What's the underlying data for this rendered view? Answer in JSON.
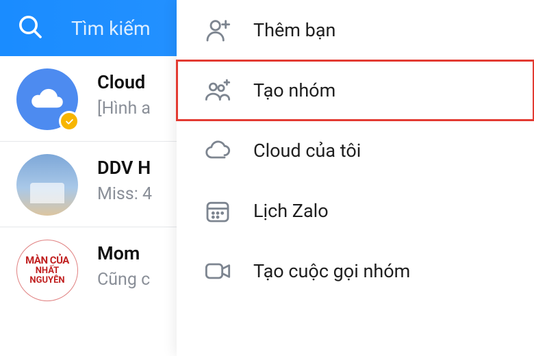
{
  "header": {
    "search_placeholder": "Tìm kiếm"
  },
  "chats": [
    {
      "title": "Cloud",
      "subtitle": "[Hình a"
    },
    {
      "title": "DDV H",
      "subtitle": "Miss: 4"
    },
    {
      "title": "Mom",
      "subtitle": "Cũng c"
    }
  ],
  "menu": {
    "items": [
      {
        "label": "Thêm bạn",
        "icon": "add-friend-icon",
        "highlighted": false
      },
      {
        "label": "Tạo nhóm",
        "icon": "create-group-icon",
        "highlighted": true
      },
      {
        "label": "Cloud của tôi",
        "icon": "cloud-icon",
        "highlighted": false
      },
      {
        "label": "Lịch Zalo",
        "icon": "calendar-icon",
        "highlighted": false
      },
      {
        "label": "Tạo cuộc gọi nhóm",
        "icon": "video-call-icon",
        "highlighted": false
      }
    ]
  },
  "avatar_sign": {
    "line1": "MÀN CỦA",
    "line2": "NHẤT NGUYÊN"
  },
  "colors": {
    "header_gradient_start": "#1a8cff",
    "header_gradient_end": "#3399ff",
    "highlight_border": "#e33b32",
    "badge": "#f7b500"
  }
}
